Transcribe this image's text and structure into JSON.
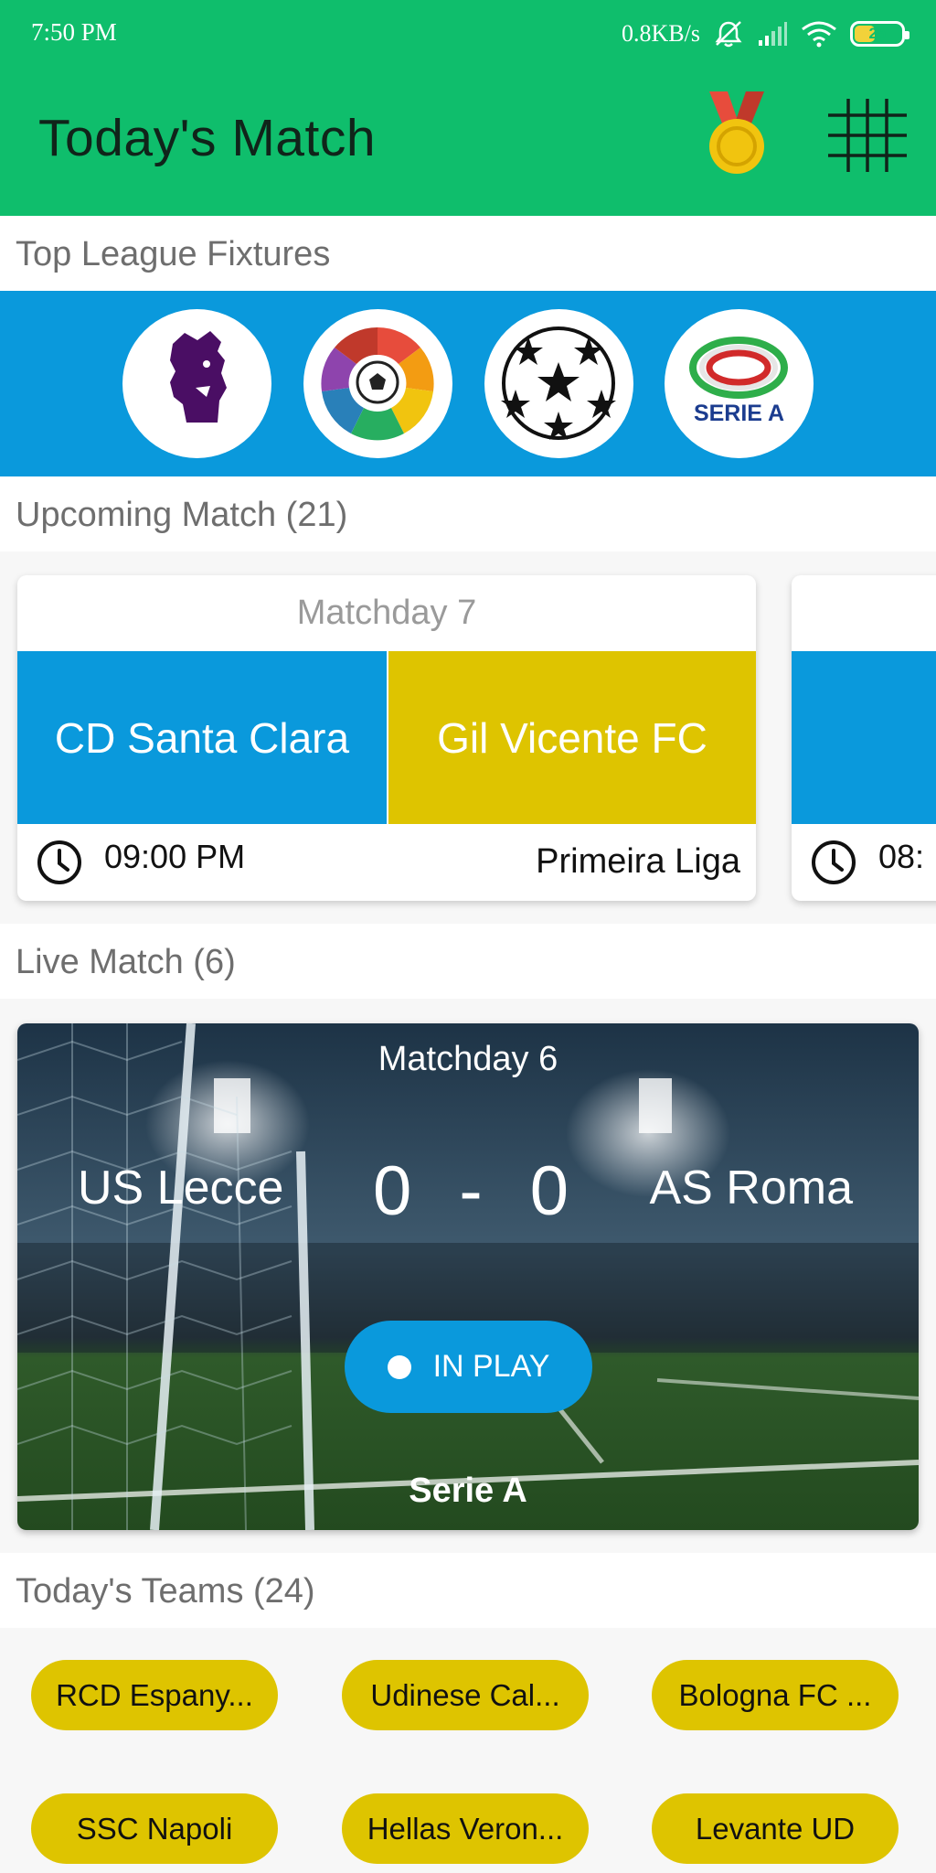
{
  "status_bar": {
    "time": "7:50 PM",
    "network_speed": "0.8KB/s",
    "battery": "25",
    "icons": [
      "mute-icon",
      "signal-icon",
      "wifi-icon",
      "battery-icon"
    ]
  },
  "app_bar": {
    "title": "Today's Match",
    "icons": [
      "medal-icon",
      "grid-icon"
    ]
  },
  "colors": {
    "app_bar": "#0fbe6c",
    "accent_blue": "#0a99dc",
    "accent_yellow": "#dec400"
  },
  "top_leagues": {
    "header": "Top League Fixtures",
    "leagues": [
      {
        "icon": "premier-league-logo"
      },
      {
        "icon": "laliga-logo"
      },
      {
        "icon": "champions-league-logo"
      },
      {
        "icon": "serie-a-logo",
        "text": "SERIE A"
      }
    ]
  },
  "upcoming": {
    "header": "Upcoming Match (21)",
    "cards": [
      {
        "matchday": "Matchday 7",
        "home_team": "CD Santa Clara",
        "away_team": "Gil Vicente FC",
        "time": "09:00 PM",
        "league": "Primeira Liga"
      },
      {
        "time": "08:"
      }
    ]
  },
  "live": {
    "header": "Live Match (6)",
    "card": {
      "matchday": "Matchday 6",
      "home_team": "US Lecce",
      "home_score": "0",
      "separator": "-",
      "away_score": "0",
      "away_team": "AS Roma",
      "status": "IN PLAY",
      "league": "Serie A"
    }
  },
  "teams": {
    "header": "Today's Teams (24)",
    "items": [
      {
        "label": "RCD Espany..."
      },
      {
        "label": "Udinese Cal..."
      },
      {
        "label": "Bologna FC ..."
      },
      {
        "label": "SSC Napoli"
      },
      {
        "label": "Hellas Veron..."
      },
      {
        "label": "Levante UD"
      }
    ]
  }
}
